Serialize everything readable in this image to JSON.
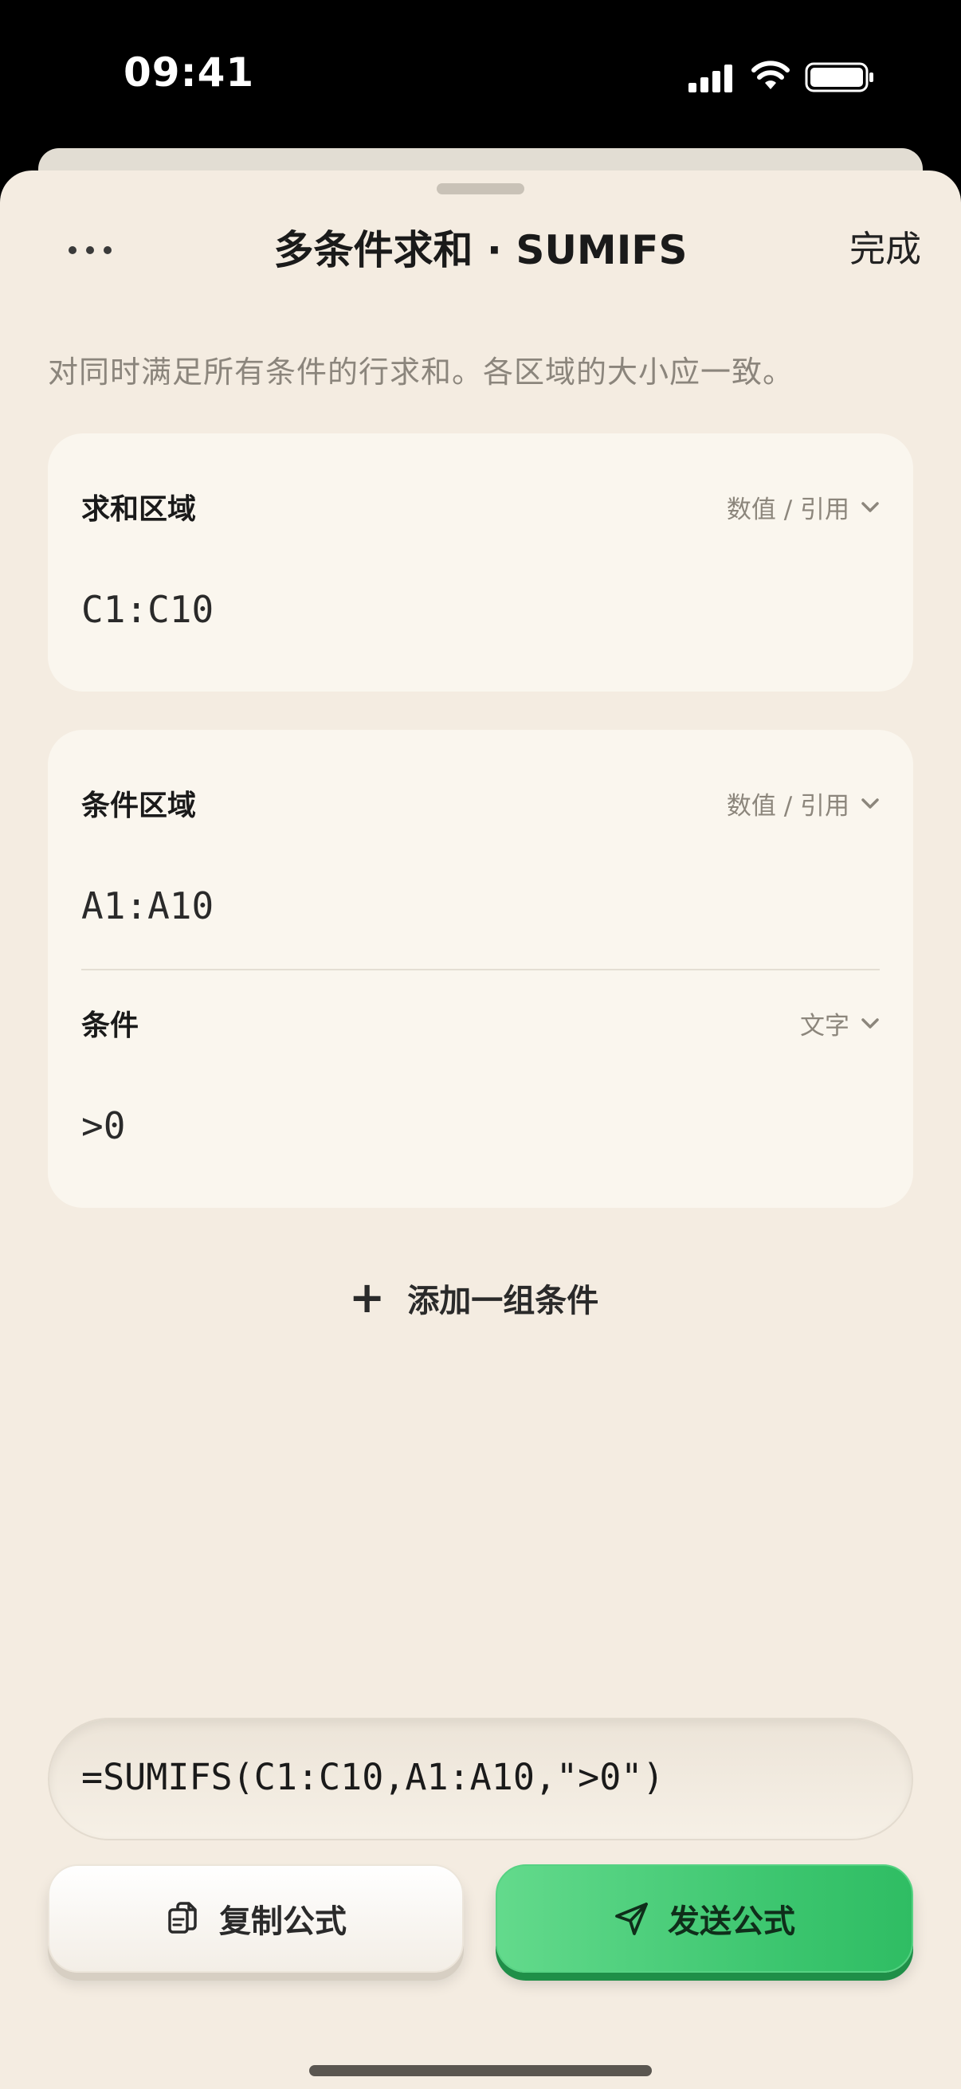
{
  "status_bar": {
    "time": "09:41"
  },
  "nav": {
    "title": "多条件求和 · SUMIFS",
    "done_label": "完成",
    "more_icon": "ellipsis-icon"
  },
  "description": "对同时满足所有条件的行求和。各区域的大小应一致。",
  "sum_range": {
    "label": "求和区域",
    "type": "数值 / 引用",
    "value": "C1:C10"
  },
  "criteria_group": {
    "range": {
      "label": "条件区域",
      "type": "数值 / 引用",
      "value": "A1:A10"
    },
    "criteria": {
      "label": "条件",
      "type": "文字",
      "value": ">0"
    }
  },
  "add_group_label": "添加一组条件",
  "formula": "=SUMIFS(C1:C10,A1:A10,\">0\")",
  "buttons": {
    "copy": "复制公式",
    "send": "发送公式"
  },
  "colors": {
    "sheet_bg": "#f4ece1",
    "card_bg": "#faf6ee",
    "send_green": "#3bc56e"
  }
}
